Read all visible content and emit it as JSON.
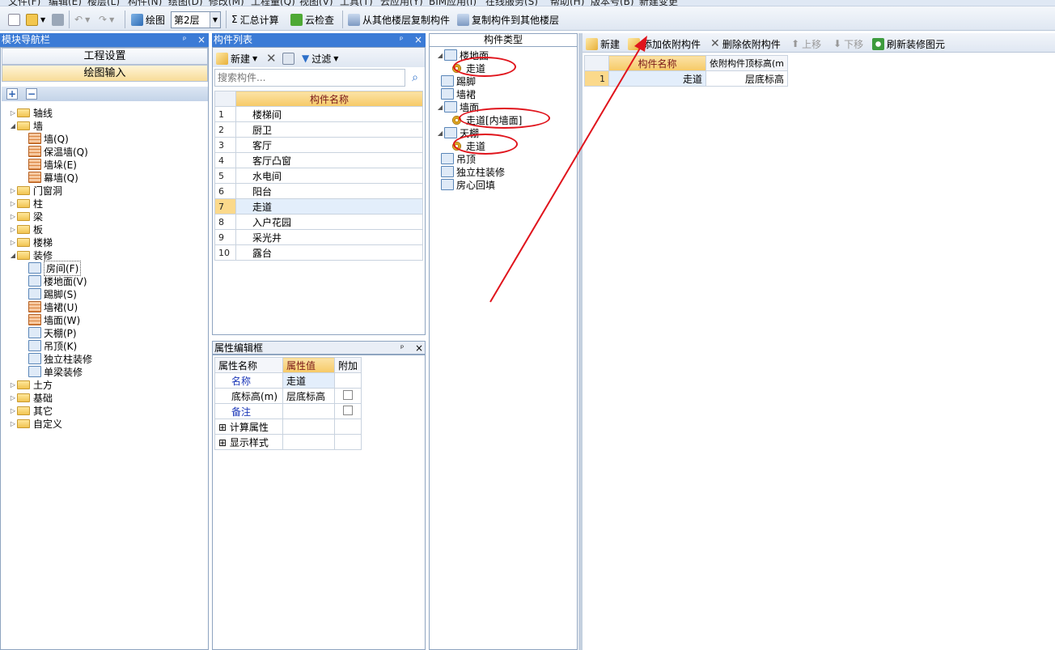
{
  "menubar": {
    "items": [
      "文件(F)",
      "编辑(E)",
      "楼层(L)",
      "构件(N)",
      "绘图(D)",
      "修改(M)",
      "工程量(Q)",
      "视图(V)",
      "工具(T)",
      "云应用(Y)",
      "BIM应用(I)",
      "在线服务(S)",
      "帮助(H)",
      "版本号(B)",
      "新建变更"
    ]
  },
  "toolbar": {
    "draw_label": "绘图",
    "floor_value": "第2层",
    "sum_label": "汇总计算",
    "cloud_check_label": "云检查",
    "copy_from_floor_label": "从其他楼层复制构件",
    "copy_to_floor_label": "复制构件到其他楼层"
  },
  "nav": {
    "title": "模块导航栏",
    "pin": "ᵖ",
    "close": "×",
    "btn_project": "工程设置",
    "btn_draw": "绘图输入",
    "plus": "+",
    "minus": "−",
    "tree": [
      {
        "label": "轴线",
        "level": 0,
        "exp": "▷"
      },
      {
        "label": "墙",
        "level": 0,
        "exp": "◢"
      },
      {
        "label": "墙(Q)",
        "level": 1
      },
      {
        "label": "保温墙(Q)",
        "level": 1
      },
      {
        "label": "墙垛(E)",
        "level": 1
      },
      {
        "label": "幕墙(Q)",
        "level": 1
      },
      {
        "label": "门窗洞",
        "level": 0,
        "exp": "▷"
      },
      {
        "label": "柱",
        "level": 0,
        "exp": "▷"
      },
      {
        "label": "梁",
        "level": 0,
        "exp": "▷"
      },
      {
        "label": "板",
        "level": 0,
        "exp": "▷"
      },
      {
        "label": "楼梯",
        "level": 0,
        "exp": "▷"
      },
      {
        "label": "装修",
        "level": 0,
        "exp": "◢"
      },
      {
        "label": "房间(F)",
        "level": 1
      },
      {
        "label": "楼地面(V)",
        "level": 1
      },
      {
        "label": "踢脚(S)",
        "level": 1
      },
      {
        "label": "墙裙(U)",
        "level": 1
      },
      {
        "label": "墙面(W)",
        "level": 1
      },
      {
        "label": "天棚(P)",
        "level": 1
      },
      {
        "label": "吊顶(K)",
        "level": 1
      },
      {
        "label": "独立柱装修",
        "level": 1
      },
      {
        "label": "单梁装修",
        "level": 1
      },
      {
        "label": "土方",
        "level": 0,
        "exp": "▷"
      },
      {
        "label": "基础",
        "level": 0,
        "exp": "▷"
      },
      {
        "label": "其它",
        "level": 0,
        "exp": "▷"
      },
      {
        "label": "自定义",
        "level": 0,
        "exp": "▷"
      }
    ]
  },
  "list": {
    "title": "构件列表",
    "new_label": "新建",
    "filter_label": "过滤",
    "search_placeholder": "搜索构件...",
    "col_header": "构件名称",
    "rows": [
      {
        "n": "1",
        "name": "楼梯间"
      },
      {
        "n": "2",
        "name": "厨卫"
      },
      {
        "n": "3",
        "name": "客厅"
      },
      {
        "n": "4",
        "name": "客厅凸窗"
      },
      {
        "n": "5",
        "name": "水电间"
      },
      {
        "n": "6",
        "name": "阳台"
      },
      {
        "n": "7",
        "name": "走道"
      },
      {
        "n": "8",
        "name": "入户花园"
      },
      {
        "n": "9",
        "name": "采光井"
      },
      {
        "n": "10",
        "name": "露台"
      }
    ]
  },
  "props": {
    "title": "属性编辑框",
    "h_name": "属性名称",
    "h_value": "属性值",
    "h_extra": "附加",
    "rows": [
      {
        "name": "名称",
        "value": "走道"
      },
      {
        "name": "底标高(m)",
        "value": "层底标高"
      },
      {
        "name": "备注",
        "value": ""
      },
      {
        "name": "计算属性",
        "value": ""
      },
      {
        "name": "显示样式",
        "value": ""
      }
    ]
  },
  "types": {
    "title": "构件类型",
    "items": [
      {
        "label": "楼地面"
      },
      {
        "label": "走道"
      },
      {
        "label": "踢脚"
      },
      {
        "label": "墙裙"
      },
      {
        "label": "墙面"
      },
      {
        "label": "走道[内墙面]"
      },
      {
        "label": "天棚"
      },
      {
        "label": "走道"
      },
      {
        "label": "吊顶"
      },
      {
        "label": "独立柱装修"
      },
      {
        "label": "房心回填"
      }
    ]
  },
  "attach": {
    "new_label": "新建",
    "add_label": "添加依附构件",
    "del_label": "删除依附构件",
    "up_label": "上移",
    "down_label": "下移",
    "refresh_label": "刷新装修图元",
    "col_name": "构件名称",
    "col_height": "依附构件顶标高(m",
    "rows": [
      {
        "n": "1",
        "name": "走道",
        "height": "层底标高"
      }
    ]
  },
  "colors": {
    "panel_header": "#3b7bd6",
    "annotation": "#e0141c",
    "grid_header": "#f6c966"
  }
}
